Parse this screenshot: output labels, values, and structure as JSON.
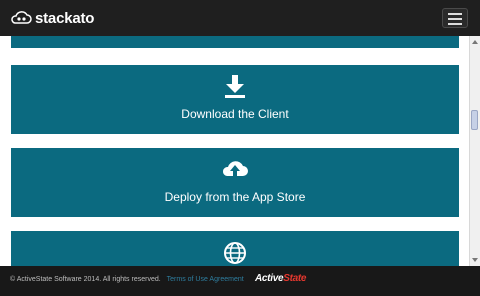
{
  "brand": {
    "name": "stackato"
  },
  "tiles": [
    {
      "label": "Download the Client",
      "icon": "download-icon"
    },
    {
      "label": "Deploy from the App Store",
      "icon": "cloud-upload-icon"
    },
    {
      "label": "",
      "icon": "globe-icon"
    }
  ],
  "footer": {
    "copyright": "© ActiveState Software 2014. All rights reserved.",
    "terms_link": "Terms of Use Agreement",
    "logo_part1": "Active",
    "logo_part2": "State"
  },
  "colors": {
    "tile": "#0b6a80",
    "navbar": "#1f1f1f",
    "footer": "#181818",
    "link": "#2f7fa0",
    "logo_accent": "#e6382f"
  }
}
